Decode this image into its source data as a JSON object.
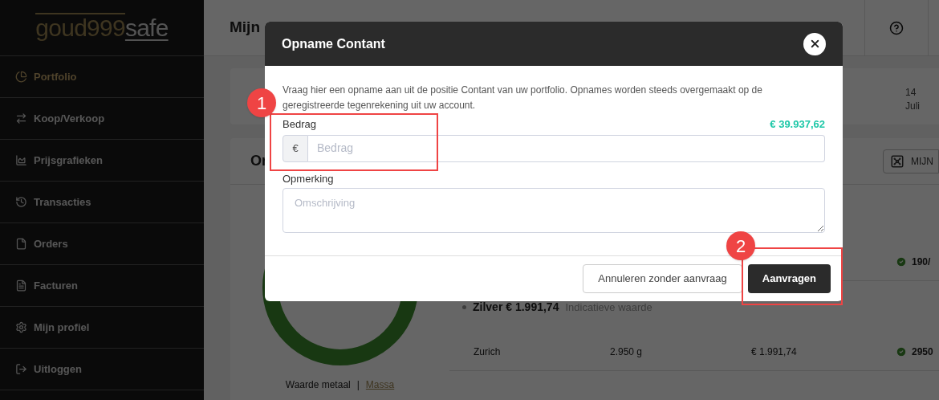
{
  "sidebar": {
    "logo": {
      "brand": "goud999",
      "suffix": "safe"
    },
    "items": [
      {
        "label": "Portfolio",
        "kind": "pie",
        "selected": true
      },
      {
        "label": "Koop/Verkoop",
        "kind": "swap",
        "selected": false
      },
      {
        "label": "Prijsgrafieken",
        "kind": "chart",
        "selected": false
      },
      {
        "label": "Transacties",
        "kind": "history",
        "selected": false
      },
      {
        "label": "Orders",
        "kind": "file",
        "selected": false
      },
      {
        "label": "Facturen",
        "kind": "invoice",
        "selected": false
      },
      {
        "label": "Mijn profiel",
        "kind": "gear",
        "selected": false
      },
      {
        "label": "Uitloggen",
        "kind": "logout",
        "selected": false
      }
    ]
  },
  "header": {
    "title": "Mijn"
  },
  "date_card": {
    "day": "14",
    "month": "Juli"
  },
  "holdings": {
    "title": "Or",
    "safe_button": "MIJN",
    "caption": "Waarde metaal",
    "separator": "|",
    "mass_link": "Massa",
    "rows": [
      {
        "kind": "item",
        "name": "",
        "weight": "",
        "value": "",
        "status": "190/"
      },
      {
        "kind": "heading",
        "name": "Zilver € 1.991,74",
        "note": "Indicatieve waarde"
      },
      {
        "kind": "item",
        "name": "Zurich",
        "weight": "2.950 g",
        "value": "€ 1.991,74",
        "status": "2950"
      }
    ]
  },
  "modal": {
    "title": "Opname Contant",
    "description": "Vraag hier een opname aan uit de positie Contant van uw portfolio. Opnames worden steeds overgemaakt op de geregistreerde tegenrekening uit uw account.",
    "amount_label": "Bedrag",
    "balance": "€ 39.937,62",
    "currency": "€",
    "amount_placeholder": "Bedrag",
    "remark_label": "Opmerking",
    "remark_placeholder": "Omschrijving",
    "cancel": "Annuleren zonder aanvraag",
    "submit": "Aanvragen"
  },
  "annotations": [
    {
      "number": "1"
    },
    {
      "number": "2"
    }
  ]
}
